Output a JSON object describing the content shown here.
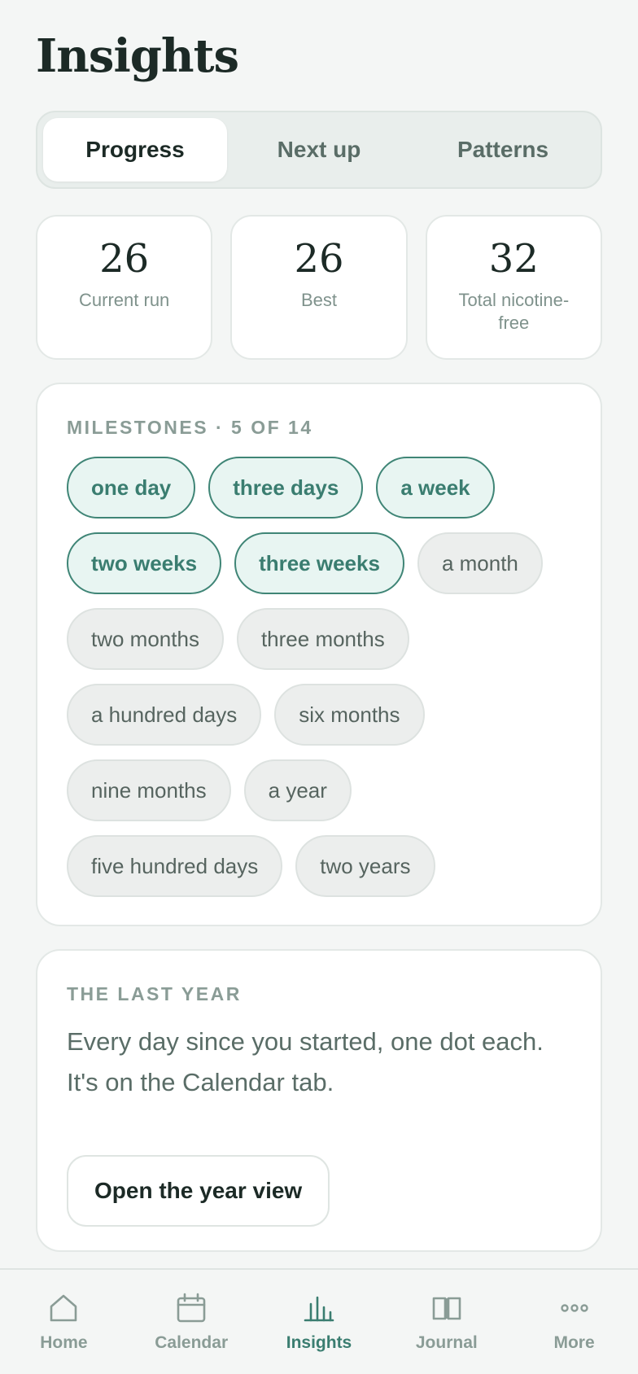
{
  "page": {
    "title": "Insights"
  },
  "segments": [
    {
      "label": "Progress",
      "active": true
    },
    {
      "label": "Next up",
      "active": false
    },
    {
      "label": "Patterns",
      "active": false
    }
  ],
  "stats": [
    {
      "value": "26",
      "label": "Current run"
    },
    {
      "value": "26",
      "label": "Best"
    },
    {
      "value": "32",
      "label": "Total nicotine-free"
    }
  ],
  "milestones": {
    "heading": "Milestones · 5 of 14",
    "items": [
      {
        "label": "one day",
        "achieved": true
      },
      {
        "label": "three days",
        "achieved": true
      },
      {
        "label": "a week",
        "achieved": true
      },
      {
        "label": "two weeks",
        "achieved": true
      },
      {
        "label": "three weeks",
        "achieved": true
      },
      {
        "label": "a month",
        "achieved": false
      },
      {
        "label": "two months",
        "achieved": false
      },
      {
        "label": "three months",
        "achieved": false
      },
      {
        "label": "a hundred days",
        "achieved": false
      },
      {
        "label": "six months",
        "achieved": false
      },
      {
        "label": "nine months",
        "achieved": false
      },
      {
        "label": "a year",
        "achieved": false
      },
      {
        "label": "five hundred days",
        "achieved": false
      },
      {
        "label": "two years",
        "achieved": false
      }
    ]
  },
  "last_year": {
    "heading": "The last year",
    "body": "Every day since you started, one dot each. It's on the Calendar tab.",
    "button": "Open the year view"
  },
  "tabbar": {
    "items": [
      {
        "label": "Home",
        "icon": "home-icon",
        "active": false
      },
      {
        "label": "Calendar",
        "icon": "calendar-icon",
        "active": false
      },
      {
        "label": "Insights",
        "icon": "bar-chart-icon",
        "active": true
      },
      {
        "label": "Journal",
        "icon": "book-icon",
        "active": false
      },
      {
        "label": "More",
        "icon": "more-icon",
        "active": false
      }
    ]
  },
  "colors": {
    "accent": "#3a7d70",
    "accent_bg": "#e8f5f2",
    "muted": "#8a9c96",
    "background": "#f4f6f5"
  }
}
